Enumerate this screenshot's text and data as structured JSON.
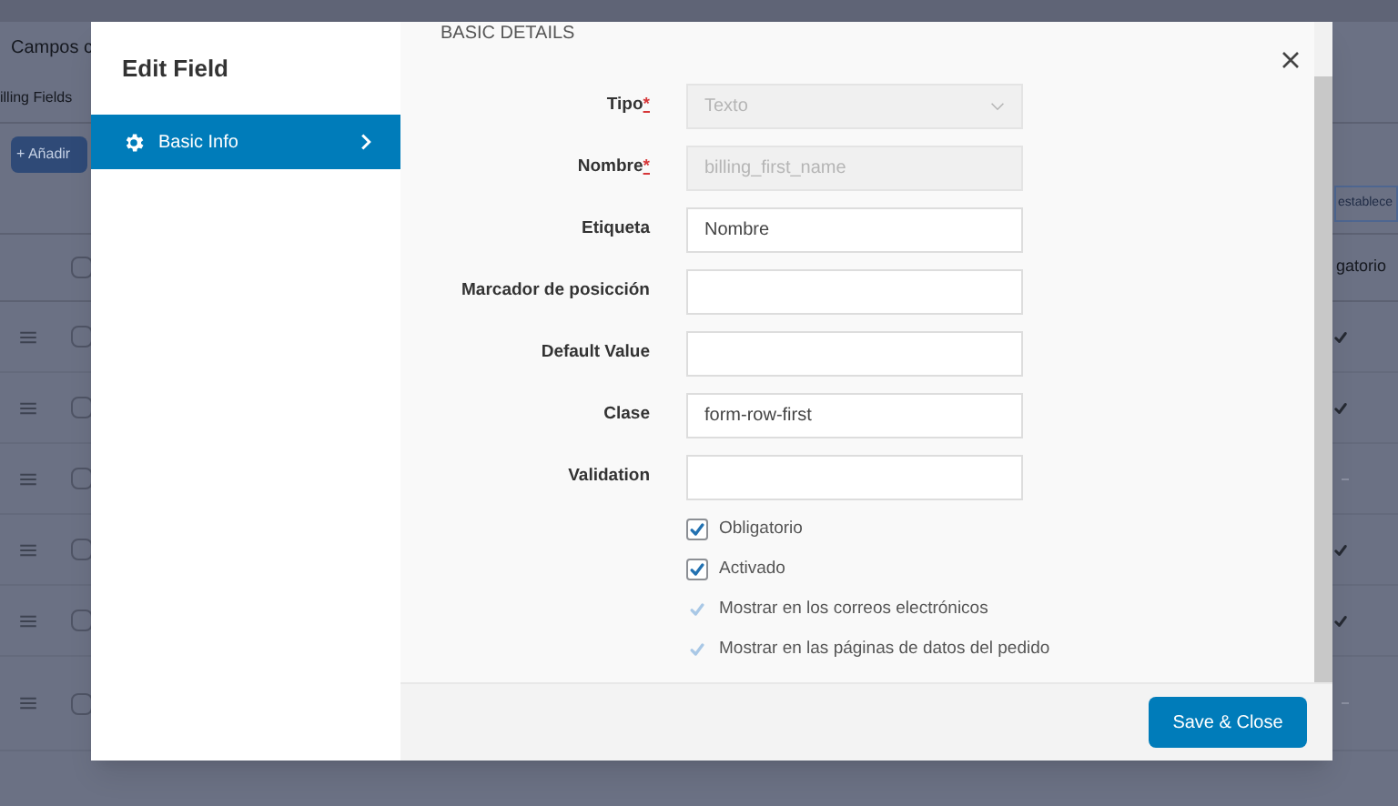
{
  "background": {
    "title": "Campos c",
    "tab": "illing Fields",
    "add_button": "+ Añadir",
    "reset_button": "establece",
    "column_header": "gatorio",
    "header_checked": false,
    "rows": [
      {
        "checked": false,
        "required": true
      },
      {
        "checked": false,
        "required": true
      },
      {
        "checked": false,
        "required": false
      },
      {
        "checked": false,
        "required": true
      },
      {
        "checked": false,
        "required": true
      },
      {
        "checked": false,
        "required": false
      }
    ]
  },
  "modal": {
    "title": "Edit Field",
    "sidebar": {
      "items": [
        {
          "label": "Basic Info",
          "selected": true
        }
      ]
    },
    "section": "BASIC DETAILS",
    "fields": [
      {
        "kind": "select",
        "label": "Tipo",
        "required_mark": "*",
        "value": "Texto",
        "disabled": true
      },
      {
        "kind": "input",
        "label": "Nombre",
        "required_mark": "*",
        "value": "billing_first_name",
        "disabled": true
      },
      {
        "kind": "input",
        "label": "Etiqueta",
        "value": "Nombre",
        "disabled": false
      },
      {
        "kind": "input",
        "label": "Marcador de posicción",
        "disabled": false
      },
      {
        "kind": "input",
        "label": "Default Value",
        "disabled": false
      },
      {
        "kind": "input",
        "label": "Clase",
        "value": "form-row-first",
        "disabled": false
      },
      {
        "kind": "input",
        "label": "Validation",
        "disabled": false
      }
    ],
    "checkboxes": [
      {
        "label": "Obligatorio",
        "checked": true,
        "disabled": false
      },
      {
        "label": "Activado",
        "checked": true,
        "disabled": false
      },
      {
        "label": "Mostrar en los correos electrónicos",
        "checked": true,
        "disabled": true
      },
      {
        "label": "Mostrar en las páginas de datos del pedido",
        "checked": true,
        "disabled": true
      }
    ],
    "save_button": "Save & Close"
  }
}
